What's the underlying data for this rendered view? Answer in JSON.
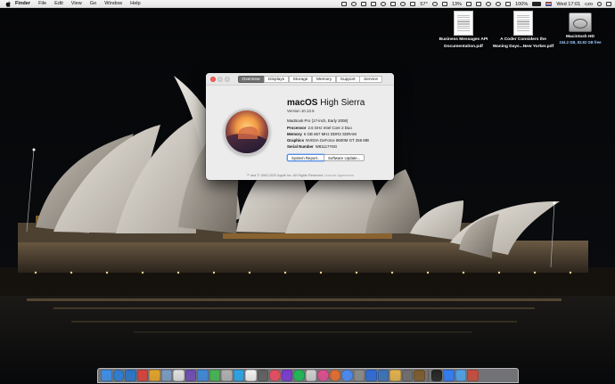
{
  "menubar": {
    "items": [
      "Finder",
      "File",
      "Edit",
      "View",
      "Go",
      "Window",
      "Help"
    ],
    "status": {
      "temperature": "57°",
      "cpu_percent": "13%",
      "battery_percent": "100%",
      "clock": "Wed 17:01",
      "user": "czo"
    }
  },
  "desktop_icons": [
    {
      "name": "Business Messages API Documentation.pdf",
      "line1": "Business Messages API",
      "line2": "Documentation.pdf",
      "kind": "pdf"
    },
    {
      "name": "A Coder Considers the Waning Days...New Yorker.pdf",
      "line1": "A Coder Considers the",
      "line2": "Waning Days...New Yorker.pdf",
      "kind": "pdf"
    },
    {
      "name": "Macintosh HD",
      "line1": "Macintosh HD",
      "line2": "244.2 GB, 82.82 GB free",
      "kind": "drive"
    }
  ],
  "about": {
    "tabs": [
      "Overview",
      "Displays",
      "Storage",
      "Memory",
      "Support",
      "Service"
    ],
    "active_tab": "Overview",
    "os_name_bold": "macOS",
    "os_name_rest": " High Sierra",
    "version": "Version 10.13.6",
    "model": "MacBook Pro (17-inch, Early 2008)",
    "specs": [
      {
        "key": "Processor",
        "value": "2.6 GHz Intel Core 2 Duo"
      },
      {
        "key": "Memory",
        "value": "6 GB 667 MHz DDR2 SDRAM"
      },
      {
        "key": "Graphics",
        "value": "NVIDIA GeForce 8600M GT 256 MB"
      },
      {
        "key": "Serial Number",
        "value": "W81117Y5G"
      }
    ],
    "buttons": {
      "system_report": "System Report...",
      "software_update": "Software Update..."
    },
    "footer": "™ and © 1983-2020 Apple Inc. All Rights Reserved.",
    "footer_link": "License Agreement"
  },
  "dock": {
    "icons": [
      "finder-icon",
      "safari-icon",
      "trello-icon",
      "app-icon",
      "photos-icon",
      "preview-icon",
      "app-icon",
      "viber-icon",
      "app-icon",
      "messages-icon",
      "app-icon",
      "skype-icon",
      "calendar-icon",
      "app-icon",
      "music-icon",
      "app-icon",
      "spotify-icon",
      "app-icon",
      "itunes-icon",
      "firefox-icon",
      "chrome-icon",
      "app-icon",
      "app-icon",
      "app-icon",
      "app-icon",
      "app-icon",
      "app-icon",
      "terminal-icon",
      "app-icon",
      "app-icon",
      "app-icon"
    ],
    "colors": [
      "#3b8ee8",
      "#2a7ed8",
      "#2874c9",
      "#d9413a",
      "#e4a326",
      "#7a9bc4",
      "#e0e0e0",
      "#6d4bb3",
      "#3c88d9",
      "#44b650",
      "#b0b0b0",
      "#2aa5e8",
      "#f2f2f2",
      "#5f5f5f",
      "#e94b5e",
      "#7a3ad0",
      "#1db954",
      "#d0d0d0",
      "#df4c8d",
      "#e66c2c",
      "#4a8af4",
      "#8a8a8a",
      "#2d6ad6",
      "#3a72b8",
      "#e3b14a",
      "#6d6d6d",
      "#7a5a2b",
      "#222222",
      "#2e7cf6",
      "#4ea1e6",
      "#c84b3a"
    ]
  }
}
